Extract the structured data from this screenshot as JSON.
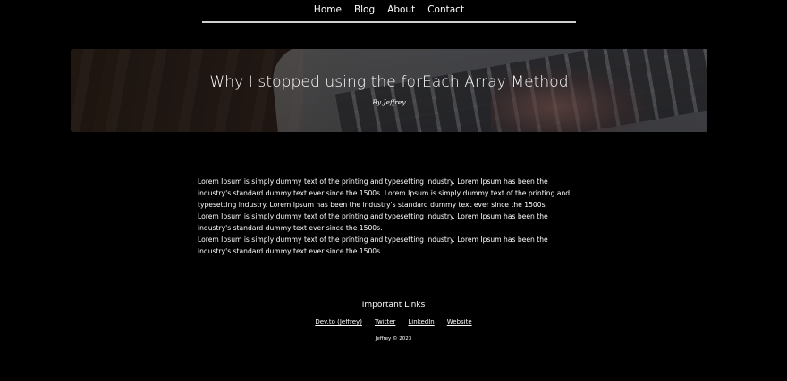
{
  "nav": {
    "items": [
      {
        "label": "Home"
      },
      {
        "label": "Blog"
      },
      {
        "label": "About"
      },
      {
        "label": "Contact"
      }
    ]
  },
  "hero": {
    "title": "Why I stopped using the forEach Array Method",
    "author": "By Jeffrey"
  },
  "article": {
    "paragraphs": [
      "Lorem Ipsum is simply dummy text of the printing and typesetting industry. Lorem Ipsum has been the industry's standard dummy text ever since the 1500s. Lorem Ipsum is simply dummy text of the printing and typesetting industry. Lorem Ipsum has been the industry's standard dummy text ever since the 1500s.",
      "Lorem Ipsum is simply dummy text of the printing and typesetting industry. Lorem Ipsum has been the industry's standard dummy text ever since the 1500s.",
      "Lorem Ipsum is simply dummy text of the printing and typesetting industry. Lorem Ipsum has been the industry's standard dummy text ever since the 1500s."
    ]
  },
  "footer": {
    "title": "Important Links",
    "links": [
      {
        "label": "Dev.to (Jeffrey)"
      },
      {
        "label": "Twitter"
      },
      {
        "label": "LinkedIn"
      },
      {
        "label": "Website"
      }
    ],
    "copyright": "Jeffrey © 2023"
  },
  "colors": {
    "background": "#000000",
    "text": "#ffffff",
    "divider": "#cfcfcf"
  }
}
